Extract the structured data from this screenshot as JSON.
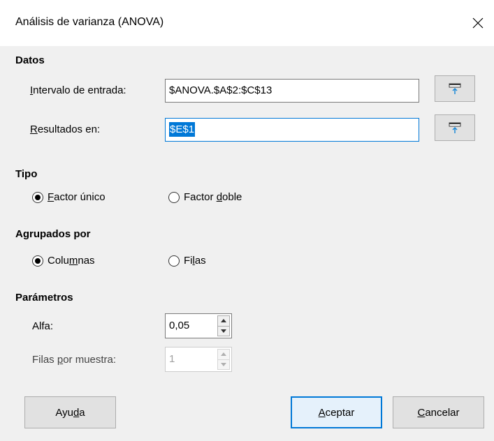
{
  "window": {
    "title": "Análisis de varianza (ANOVA)",
    "close_icon": "close-icon"
  },
  "datos": {
    "heading": "Datos",
    "input_range": {
      "label_pre": "",
      "label_ul": "I",
      "label_post": "ntervalo de entrada:",
      "value": "$ANOVA.$A$2:$C$13"
    },
    "results_to": {
      "label_pre": "",
      "label_ul": "R",
      "label_post": "esultados en:",
      "value": "$E$1"
    },
    "shrink_icon": "shrink-icon"
  },
  "tipo": {
    "heading": "Tipo",
    "options": [
      {
        "pre": "",
        "ul": "F",
        "post": "actor único",
        "checked": true
      },
      {
        "pre": "Factor ",
        "ul": "d",
        "post": "oble",
        "checked": false
      }
    ]
  },
  "agrupados": {
    "heading": "Agrupados por",
    "options": [
      {
        "pre": "Colu",
        "ul": "m",
        "post": "nas",
        "checked": true
      },
      {
        "pre": "Fi",
        "ul": "l",
        "post": "as",
        "checked": false
      }
    ]
  },
  "parametros": {
    "heading": "Parámetros",
    "alfa": {
      "label": "Alfa:",
      "value": "0,05"
    },
    "filas_por_muestra": {
      "pre": "Filas ",
      "ul": "p",
      "post": "or muestra:",
      "value": "1",
      "disabled": true
    }
  },
  "buttons": {
    "help": {
      "pre": "Ayu",
      "ul": "d",
      "post": "a"
    },
    "ok": {
      "pre": "",
      "ul": "A",
      "post": "ceptar"
    },
    "cancel": {
      "pre": "",
      "ul": "C",
      "post": "ancelar"
    }
  }
}
